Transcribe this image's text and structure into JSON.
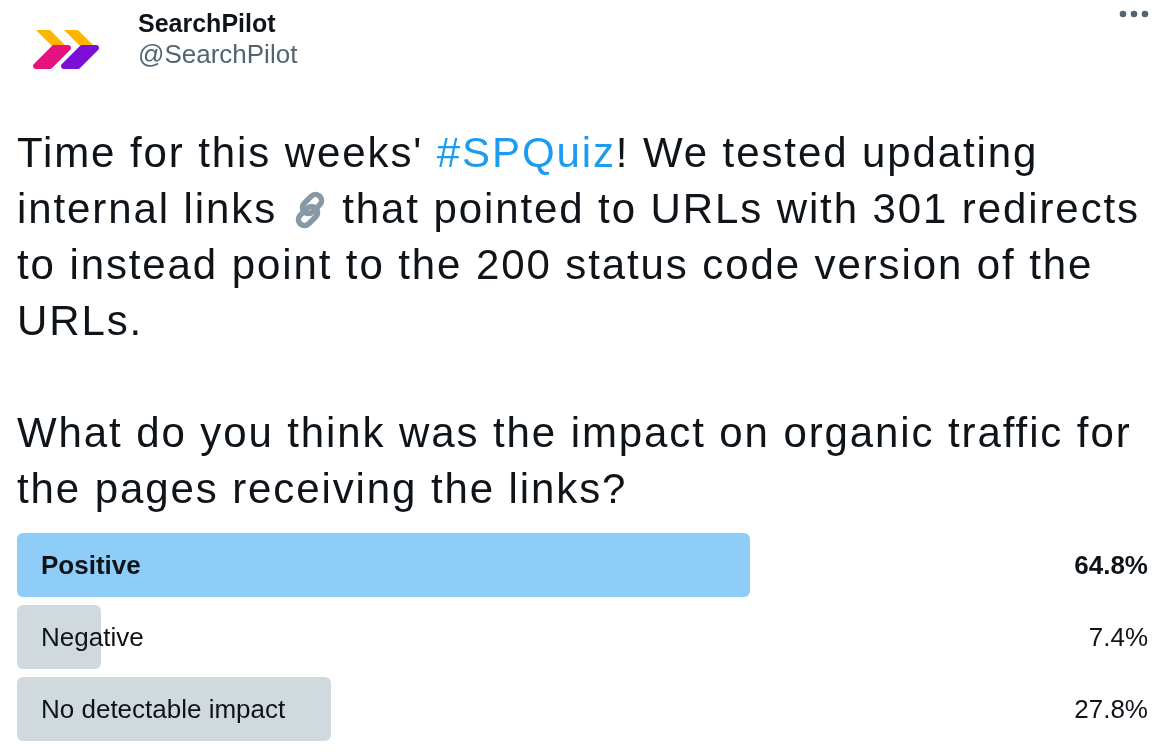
{
  "author": {
    "name": "SearchPilot",
    "handle": "@SearchPilot"
  },
  "tweet": {
    "paragraphs": [
      [
        {
          "kind": "text",
          "text": "Time for this weeks' "
        },
        {
          "kind": "hashtag",
          "text": "#SPQuiz"
        },
        {
          "kind": "text",
          "text": "! We tested updating internal links "
        },
        {
          "kind": "emoji"
        },
        {
          "kind": "text",
          "text": " that pointed to URLs with 301 redirects to instead point to the 200 status code version of the URLs."
        }
      ],
      [
        {
          "kind": "text",
          "text": "What do you think was the impact on organic traffic for the pages receiving the links?"
        }
      ]
    ]
  },
  "poll": {
    "options": [
      {
        "label": "Positive",
        "percent": "64.8%",
        "selected": true
      },
      {
        "label": "Negative",
        "percent": "7.4%",
        "selected": false
      },
      {
        "label": "No detectable impact",
        "percent": "27.8%",
        "selected": false
      }
    ]
  }
}
